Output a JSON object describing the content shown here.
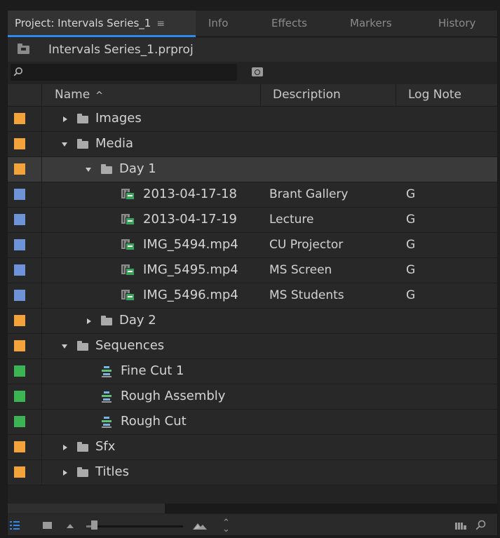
{
  "tabs": [
    {
      "label": "Project: Intervals Series_1",
      "menu_glyph": "≡",
      "active": true
    },
    {
      "label": "Info"
    },
    {
      "label": "Effects"
    },
    {
      "label": "Markers"
    },
    {
      "label": "History"
    }
  ],
  "project_file": "Intervals Series_1.prproj",
  "search": {
    "placeholder": ""
  },
  "columns": {
    "name": "Name",
    "sort_indicator": "^",
    "description": "Description",
    "log_note": "Log Note"
  },
  "label_colors": {
    "orange": "#f4a23a",
    "blue": "#6e93d8",
    "green": "#3cb453"
  },
  "rows": [
    {
      "name": "Images",
      "type": "folder",
      "expanded": false,
      "depth": 0,
      "label_color": "orange",
      "description": "",
      "log_note": ""
    },
    {
      "name": "Media",
      "type": "folder",
      "expanded": true,
      "depth": 0,
      "label_color": "orange",
      "description": "",
      "log_note": ""
    },
    {
      "name": "Day 1",
      "type": "folder",
      "expanded": true,
      "depth": 1,
      "label_color": "orange",
      "description": "",
      "log_note": "",
      "selected": true
    },
    {
      "name": "2013-04-17-18",
      "type": "clip",
      "depth": 2,
      "label_color": "blue",
      "description": "Brant Gallery",
      "log_note": "G"
    },
    {
      "name": "2013-04-17-19",
      "type": "clip",
      "depth": 2,
      "label_color": "blue",
      "description": "Lecture",
      "log_note": "G"
    },
    {
      "name": "IMG_5494.mp4",
      "type": "clip",
      "depth": 2,
      "label_color": "blue",
      "description": "CU Projector",
      "log_note": "G"
    },
    {
      "name": "IMG_5495.mp4",
      "type": "clip",
      "depth": 2,
      "label_color": "blue",
      "description": "MS Screen",
      "log_note": "G"
    },
    {
      "name": "IMG_5496.mp4",
      "type": "clip",
      "depth": 2,
      "label_color": "blue",
      "description": "MS Students",
      "log_note": "G"
    },
    {
      "name": "Day 2",
      "type": "folder",
      "expanded": false,
      "depth": 1,
      "label_color": "orange",
      "description": "",
      "log_note": ""
    },
    {
      "name": "Sequences",
      "type": "folder",
      "expanded": true,
      "depth": 0,
      "label_color": "orange",
      "description": "",
      "log_note": ""
    },
    {
      "name": "Fine Cut 1",
      "type": "sequence",
      "depth": 1,
      "label_color": "green",
      "description": "",
      "log_note": ""
    },
    {
      "name": "Rough Assembly",
      "type": "sequence",
      "depth": 1,
      "label_color": "green",
      "description": "",
      "log_note": ""
    },
    {
      "name": "Rough Cut",
      "type": "sequence",
      "depth": 1,
      "label_color": "green",
      "description": "",
      "log_note": ""
    },
    {
      "name": "Sfx",
      "type": "folder",
      "expanded": false,
      "depth": 0,
      "label_color": "orange",
      "description": "",
      "log_note": ""
    },
    {
      "name": "Titles",
      "type": "folder",
      "expanded": false,
      "depth": 0,
      "label_color": "orange",
      "description": "",
      "log_note": ""
    }
  ],
  "footer": {
    "icons": [
      "list-view-icon",
      "icon-view-icon",
      "small-thumb-icon",
      "zoom-slider",
      "large-thumb-icon",
      "sort-icon",
      "bin-tools-icon",
      "find-icon"
    ],
    "zoom_level": 0.05
  }
}
